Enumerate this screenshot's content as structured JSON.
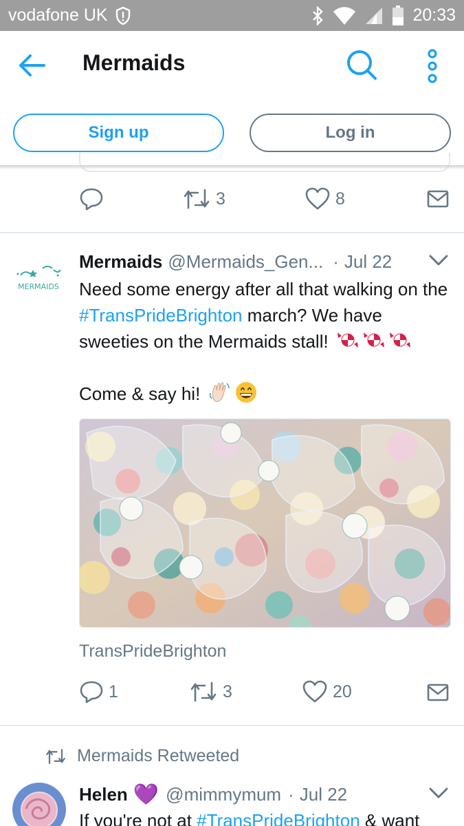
{
  "status_bar": {
    "carrier": "vodafone UK",
    "time": "20:33",
    "icons": [
      "shield-icon",
      "bluetooth-icon",
      "wifi-icon",
      "signal-icon",
      "battery-icon"
    ]
  },
  "app_bar": {
    "title": "Mermaids",
    "icons": [
      "back-arrow-icon",
      "search-icon",
      "more-vertical-icon"
    ]
  },
  "auth": {
    "signup_label": "Sign up",
    "login_label": "Log in"
  },
  "previous_tweet": {
    "retweets": "3",
    "likes": "8"
  },
  "tweet": {
    "name": "Mermaids",
    "handle": "@Mermaids_Gen...",
    "separator": "·",
    "date": "Jul 22",
    "avatar_logo_text": "MERMAIDS",
    "text_line1_prefix": "Need some energy after all that walking on the ",
    "hashtag": "#TransPrideBrighton",
    "text_line1_suffix": " march? We have sweeties on the Mermaids stall!",
    "text_line2": "Come & say hi!",
    "emojis_line1": [
      "candy-emoji",
      "candy-emoji",
      "candy-emoji"
    ],
    "emojis_line2": [
      "waving-hand-emoji",
      "grinning-face-emoji"
    ],
    "image_description_icon": "sweets-bags-photo",
    "hashtag_caption": "TransPrideBrighton",
    "replies": "1",
    "retweets": "3",
    "likes": "20"
  },
  "retweet_block": {
    "label": "Mermaids Retweeted",
    "name": "Helen",
    "heart": "💜",
    "handle": "@mimmymum",
    "separator": "·",
    "date": "Jul 22",
    "text_prefix": "If you're not at ",
    "hashtag": "#TransPrideBrighton",
    "text_suffix": " & want"
  },
  "colors": {
    "accent": "#1da1f2",
    "muted": "#657786",
    "text": "#14171a",
    "status_bar": "#9e9e9e",
    "divider": "#e1e8ed"
  }
}
